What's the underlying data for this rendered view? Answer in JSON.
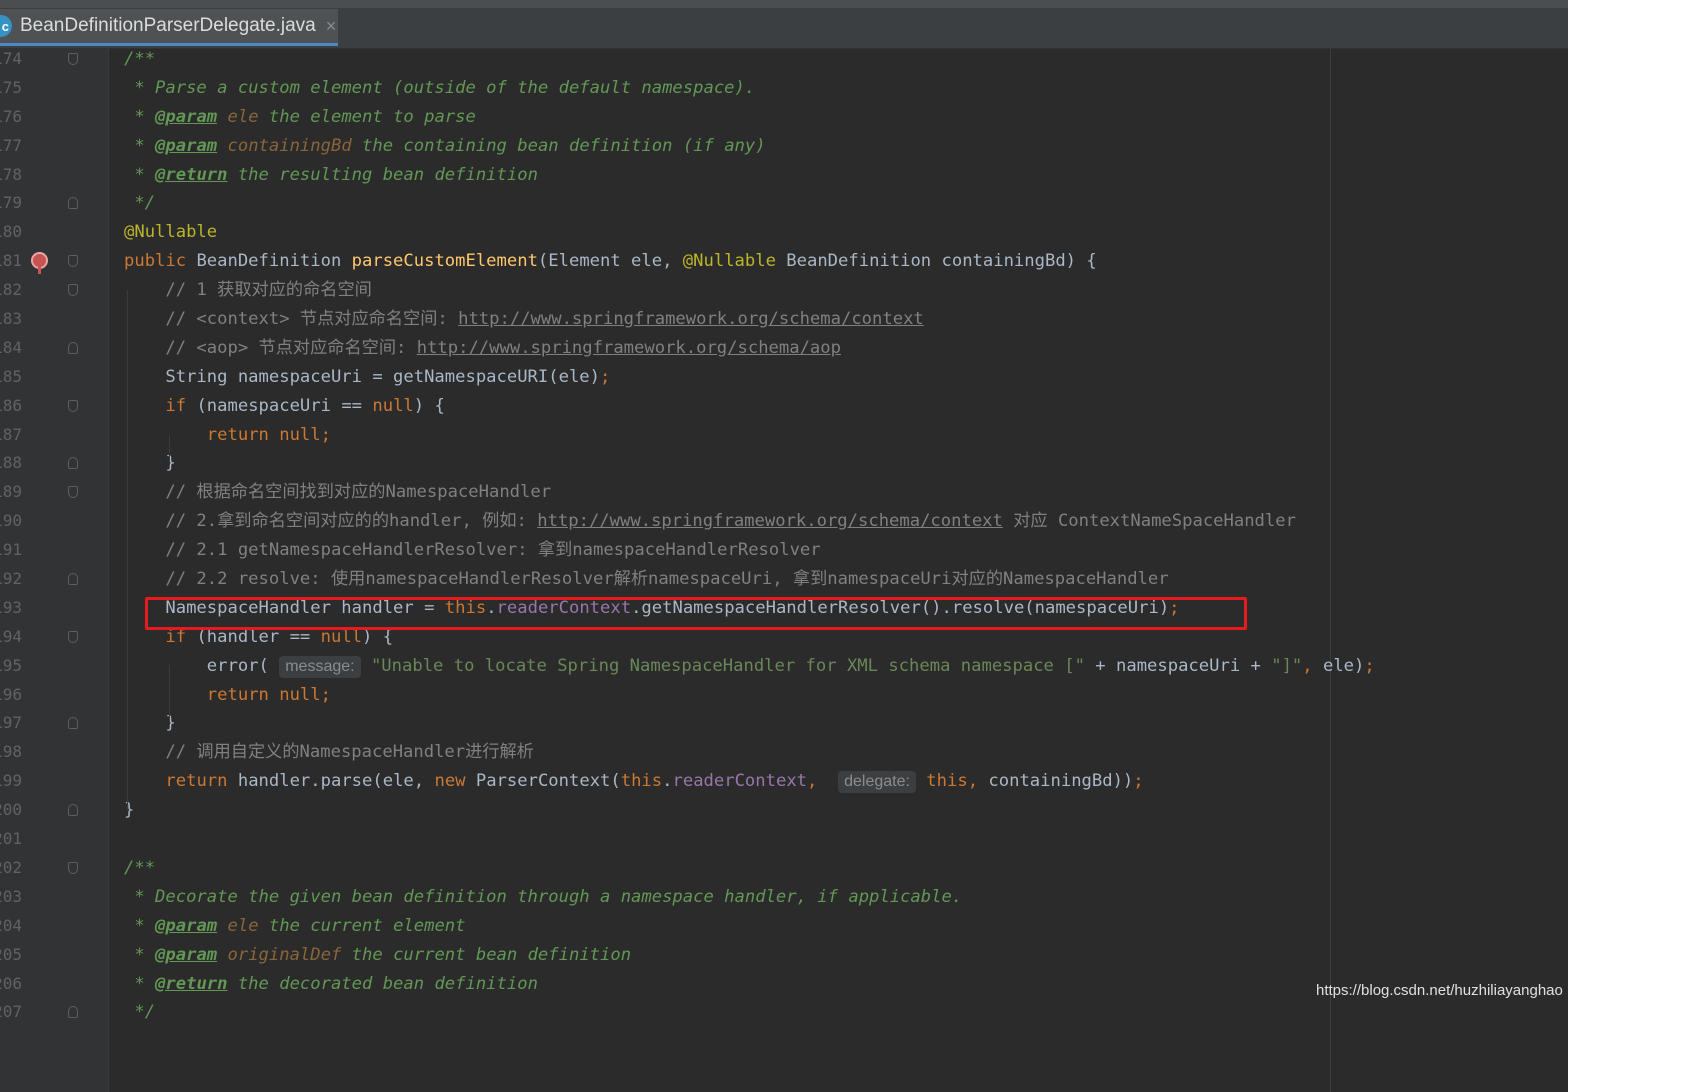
{
  "tab": {
    "icon_letter": "c",
    "title": "BeanDefinitionParserDelegate.java",
    "close": "×"
  },
  "lines": [
    {
      "num": "174",
      "fold": "start",
      "parts": [
        {
          "t": "/**",
          "c": "jd"
        }
      ]
    },
    {
      "num": "175",
      "parts": [
        {
          "t": " * Parse a custom element (outside of the default namespace).",
          "c": "jd"
        }
      ]
    },
    {
      "num": "176",
      "parts": [
        {
          "t": " * ",
          "c": "jd"
        },
        {
          "t": "@param",
          "c": "tag"
        },
        {
          "t": " ",
          "c": "jd"
        },
        {
          "t": "ele",
          "c": "pv"
        },
        {
          "t": " the element to parse",
          "c": "jd"
        }
      ]
    },
    {
      "num": "177",
      "parts": [
        {
          "t": " * ",
          "c": "jd"
        },
        {
          "t": "@param",
          "c": "tag"
        },
        {
          "t": " ",
          "c": "jd"
        },
        {
          "t": "containingBd",
          "c": "pv"
        },
        {
          "t": " the containing bean definition (if any)",
          "c": "jd"
        }
      ]
    },
    {
      "num": "178",
      "parts": [
        {
          "t": " * ",
          "c": "jd"
        },
        {
          "t": "@return",
          "c": "tag"
        },
        {
          "t": " the resulting bean definition",
          "c": "jd"
        }
      ]
    },
    {
      "num": "179",
      "fold": "end",
      "parts": [
        {
          "t": " */",
          "c": "jd"
        }
      ]
    },
    {
      "num": "180",
      "parts": [
        {
          "t": "@Nullable",
          "c": "ann"
        }
      ]
    },
    {
      "num": "181",
      "fold": "start",
      "breakpoint": true,
      "parts": [
        {
          "t": "public ",
          "c": "kw"
        },
        {
          "t": "BeanDefinition "
        },
        {
          "t": "parseCustomElement",
          "c": "fn"
        },
        {
          "t": "(Element ele, "
        },
        {
          "t": "@Nullable",
          "c": "ann"
        },
        {
          "t": " BeanDefinition containingBd) {"
        }
      ]
    },
    {
      "num": "182",
      "fold": "start",
      "parts": [
        {
          "t": "    // 1 获取对应的命名空间",
          "c": "c"
        }
      ]
    },
    {
      "num": "183",
      "parts": [
        {
          "t": "    // <context> 节点对应命名空间: ",
          "c": "c"
        },
        {
          "t": "http://www.springframework.org/schema/context",
          "c": "url"
        }
      ]
    },
    {
      "num": "184",
      "fold": "end",
      "parts": [
        {
          "t": "    // <aop> 节点对应命名空间: ",
          "c": "c"
        },
        {
          "t": "http://www.springframework.org/schema/aop",
          "c": "url"
        }
      ]
    },
    {
      "num": "185",
      "parts": [
        {
          "t": "    String namespaceUri = getNamespaceURI(ele)"
        },
        {
          "t": ";",
          "c": "kw"
        }
      ]
    },
    {
      "num": "186",
      "fold": "start",
      "parts": [
        {
          "t": "    "
        },
        {
          "t": "if",
          "c": "kw"
        },
        {
          "t": " (namespaceUri == "
        },
        {
          "t": "null",
          "c": "kw"
        },
        {
          "t": ") {"
        }
      ]
    },
    {
      "num": "187",
      "parts": [
        {
          "t": "        "
        },
        {
          "t": "return null;",
          "c": "kw"
        }
      ]
    },
    {
      "num": "188",
      "fold": "end",
      "parts": [
        {
          "t": "    }"
        }
      ]
    },
    {
      "num": "189",
      "fold": "start",
      "parts": [
        {
          "t": "    // 根据命名空间找到对应的NamespaceHandler",
          "c": "c"
        }
      ]
    },
    {
      "num": "190",
      "parts": [
        {
          "t": "    // 2.拿到命名空间对应的的handler, 例如: ",
          "c": "c"
        },
        {
          "t": "http://www.springframework.org/schema/context",
          "c": "url"
        },
        {
          "t": " 对应 ContextNameSpaceHandler",
          "c": "c"
        }
      ]
    },
    {
      "num": "191",
      "parts": [
        {
          "t": "    // 2.1 getNamespaceHandlerResolver: 拿到namespaceHandlerResolver",
          "c": "c"
        }
      ]
    },
    {
      "num": "192",
      "fold": "end",
      "parts": [
        {
          "t": "    // 2.2 resolve: 使用namespaceHandlerResolver解析namespaceUri, 拿到namespaceUri对应的NamespaceHandler",
          "c": "c"
        }
      ]
    },
    {
      "num": "193",
      "parts": [
        {
          "t": "    NamespaceHandler handler = "
        },
        {
          "t": "this",
          "c": "kw"
        },
        {
          "t": "."
        },
        {
          "t": "readerContext",
          "c": "fld"
        },
        {
          "t": ".getNamespaceHandlerResolver().resolve(namespaceUri)"
        },
        {
          "t": ";",
          "c": "kw"
        }
      ]
    },
    {
      "num": "194",
      "fold": "start",
      "parts": [
        {
          "t": "    "
        },
        {
          "t": "if",
          "c": "kw"
        },
        {
          "t": " (handler == "
        },
        {
          "t": "null",
          "c": "kw"
        },
        {
          "t": ") {"
        }
      ]
    },
    {
      "num": "195",
      "parts": [
        {
          "t": "        error( "
        },
        {
          "t": "message:",
          "c": "hint"
        },
        {
          "t": " "
        },
        {
          "t": "\"Unable to locate Spring NamespaceHandler for XML schema namespace [\"",
          "c": "str"
        },
        {
          "t": " + namespaceUri + "
        },
        {
          "t": "\"]\"",
          "c": "str"
        },
        {
          "t": ", ",
          "c": "kw"
        },
        {
          "t": "ele)"
        },
        {
          "t": ";",
          "c": "kw"
        }
      ]
    },
    {
      "num": "196",
      "parts": [
        {
          "t": "        "
        },
        {
          "t": "return null;",
          "c": "kw"
        }
      ]
    },
    {
      "num": "197",
      "fold": "end",
      "parts": [
        {
          "t": "    }"
        }
      ]
    },
    {
      "num": "198",
      "parts": [
        {
          "t": "    // 调用自定义的NamespaceHandler进行解析",
          "c": "c"
        }
      ]
    },
    {
      "num": "199",
      "parts": [
        {
          "t": "    "
        },
        {
          "t": "return",
          "c": "kw"
        },
        {
          "t": " handler.parse(ele, "
        },
        {
          "t": "new",
          "c": "kw"
        },
        {
          "t": " ParserContext("
        },
        {
          "t": "this",
          "c": "kw"
        },
        {
          "t": "."
        },
        {
          "t": "readerContext",
          "c": "fld"
        },
        {
          "t": ", ",
          "c": "kw"
        },
        {
          "t": " "
        },
        {
          "t": "delegate:",
          "c": "hint"
        },
        {
          "t": " "
        },
        {
          "t": "this",
          "c": "kw"
        },
        {
          "t": ", ",
          "c": "kw"
        },
        {
          "t": "containingBd))"
        },
        {
          "t": ";",
          "c": "kw"
        }
      ]
    },
    {
      "num": "200",
      "fold": "end",
      "parts": [
        {
          "t": "}"
        }
      ]
    },
    {
      "num": "201",
      "parts": []
    },
    {
      "num": "202",
      "fold": "start",
      "parts": [
        {
          "t": "/**",
          "c": "jd"
        }
      ]
    },
    {
      "num": "203",
      "parts": [
        {
          "t": " * Decorate the given bean definition through a namespace handler, if applicable.",
          "c": "jd"
        }
      ]
    },
    {
      "num": "204",
      "parts": [
        {
          "t": " * ",
          "c": "jd"
        },
        {
          "t": "@param",
          "c": "tag"
        },
        {
          "t": " ",
          "c": "jd"
        },
        {
          "t": "ele",
          "c": "pv"
        },
        {
          "t": " the current element",
          "c": "jd"
        }
      ]
    },
    {
      "num": "205",
      "parts": [
        {
          "t": " * ",
          "c": "jd"
        },
        {
          "t": "@param",
          "c": "tag"
        },
        {
          "t": " ",
          "c": "jd"
        },
        {
          "t": "originalDef",
          "c": "pv"
        },
        {
          "t": " the current bean definition",
          "c": "jd"
        }
      ]
    },
    {
      "num": "206",
      "parts": [
        {
          "t": " * ",
          "c": "jd"
        },
        {
          "t": "@return",
          "c": "tag"
        },
        {
          "t": " the decorated bean definition",
          "c": "jd"
        }
      ]
    },
    {
      "num": "207",
      "fold": "end",
      "parts": [
        {
          "t": " */",
          "c": "jd"
        }
      ]
    }
  ],
  "highlight": {
    "line": "193",
    "color": "#e8191f"
  },
  "watermark": "https://blog.csdn.net/huzhiliayanghao"
}
